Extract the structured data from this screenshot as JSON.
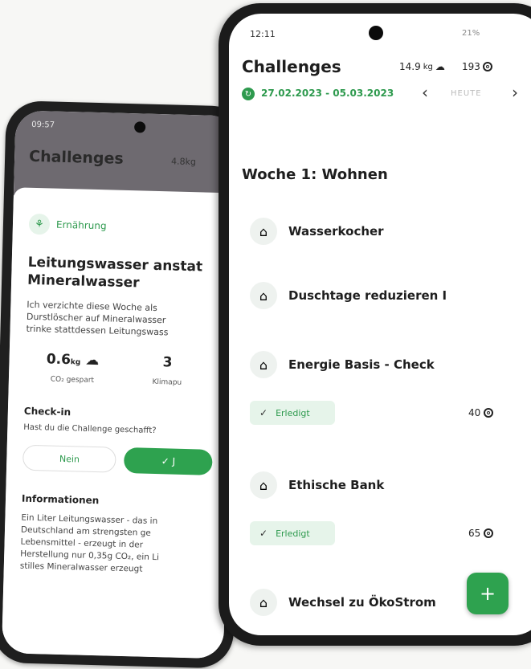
{
  "back": {
    "time": "09:57",
    "title": "Challenges",
    "kg": "4.8kg",
    "category": "Ernährung",
    "challenge_title_1": "Leitungswasser anstat",
    "challenge_title_2": "Mineralwasser",
    "desc_1": "Ich verzichte diese Woche als",
    "desc_2": "Durstlöscher auf Mineralwasser",
    "desc_3": "trinke stattdessen Leitungswass",
    "stat1_value": "0.6",
    "stat1_unit": "kg",
    "stat1_label": "CO₂ gespart",
    "stat2_value": "3",
    "stat2_label": "Klimapu",
    "checkin_title": "Check-in",
    "checkin_question": "Hast du die Challenge geschafft?",
    "no_label": "Nein",
    "yes_label": "✓ J",
    "info_title": "Informationen",
    "info_1": "Ein Liter Leitungswasser - das in",
    "info_2": "Deutschland am strengsten ge",
    "info_3": "Lebensmittel - erzeugt in der",
    "info_4": "Herstellung nur 0,35g CO₂, ein Li",
    "info_5": "stilles Mineralwasser erzeugt"
  },
  "front": {
    "time": "12:11",
    "battery": "21%",
    "title": "Challenges",
    "kg_value": "14.9",
    "kg_unit": "kg",
    "points": "193",
    "date_range": "27.02.2023 - 05.03.2023",
    "today_label": "HEUTE",
    "week_title": "Woche 1: Wohnen",
    "items": [
      {
        "name": "Wasserkocher"
      },
      {
        "name": "Duschtage reduzieren I"
      },
      {
        "name": "Energie Basis - Check"
      },
      {
        "name": "Ethische Bank"
      },
      {
        "name": "Wechsel zu ÖkoStrom"
      }
    ],
    "done_label": "Erledigt",
    "done_points_1": "40",
    "done_points_2": "65",
    "fab_label": "+"
  },
  "colors": {
    "accent": "#2e9a4e",
    "fab": "#2ea24f",
    "done_bg": "#e6f4ea"
  },
  "icons": [
    "house-icon",
    "cloud-icon",
    "coin-icon",
    "calendar-icon",
    "check-icon",
    "sprout-icon"
  ]
}
